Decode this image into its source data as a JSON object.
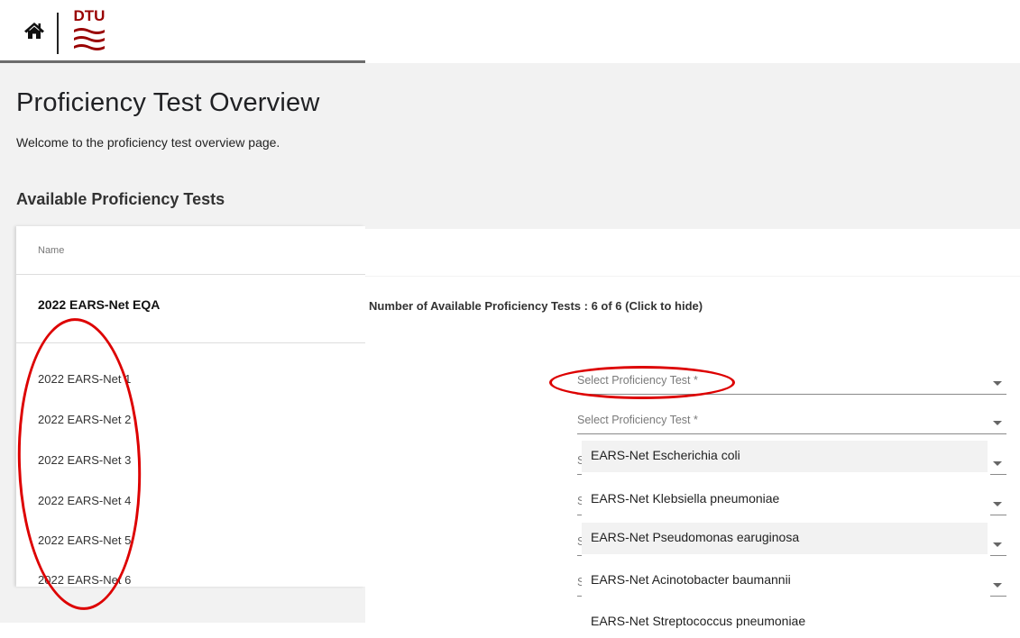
{
  "header": {
    "home_icon": "home-icon",
    "logo_text": "DTU",
    "brand_color": "#990000"
  },
  "page": {
    "title": "Proficiency Test Overview",
    "welcome": "Welcome to the proficiency test overview page.",
    "section_title": "Available Proficiency Tests"
  },
  "table": {
    "column_name": "Name",
    "group_name": "2022 EARS-Net EQA",
    "count_text": "Number of Available Proficiency Tests : 6 of 6  (Click to hide)",
    "tests": [
      "2022 EARS-Net 1",
      "2022 EARS-Net 2",
      "2022 EARS-Net 3",
      "2022 EARS-Net 4",
      "2022 EARS-Net 5",
      "2022 EARS-Net 6"
    ]
  },
  "selects": [
    {
      "placeholder": "Select Proficiency Test *"
    },
    {
      "placeholder": "Select Proficiency Test *"
    },
    {
      "placeholder": "S"
    },
    {
      "placeholder": "S"
    },
    {
      "placeholder": "S"
    },
    {
      "placeholder": "S"
    }
  ],
  "dropdown": {
    "options": [
      "EARS-Net Escherichia coli",
      "EARS-Net Klebsiella pneumoniae",
      "EARS-Net Pseudomonas earuginosa",
      "EARS-Net Acinotobacter baumannii",
      "EARS-Net Streptococcus pneumoniae"
    ]
  },
  "annotation_color": "#dd0000"
}
